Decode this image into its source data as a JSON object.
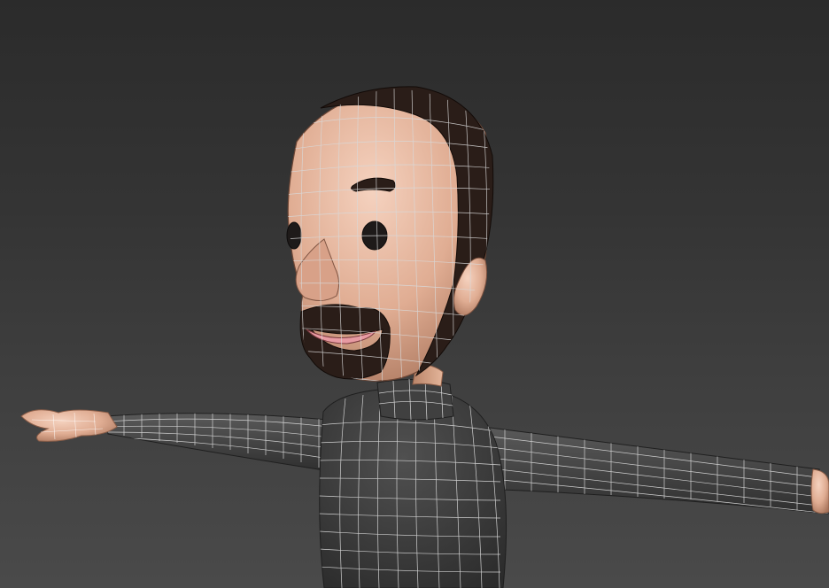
{
  "viewport": {
    "colors": {
      "background_top": "#2b2b2b",
      "background_bottom": "#4a4a4a",
      "skin": "#e3b59a",
      "skin_shadow": "#b9846a",
      "hair": "#2a1d18",
      "shirt": "#3b3b3b",
      "wire": "#d9d9d9",
      "lips": "#e79aa2"
    },
    "model": {
      "icon": "character-mesh-icon"
    }
  }
}
